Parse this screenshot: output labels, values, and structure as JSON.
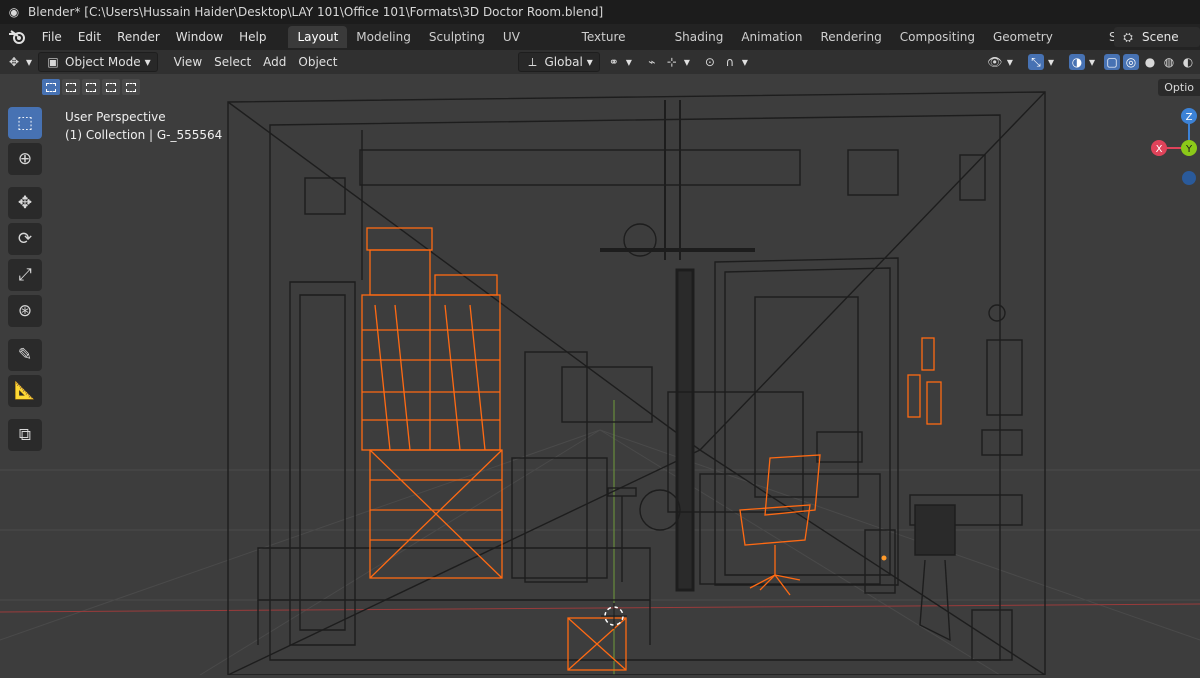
{
  "window": {
    "title": "Blender* [C:\\Users\\Hussain Haider\\Desktop\\LAY 101\\Office 101\\Formats\\3D Doctor Room.blend]"
  },
  "menu": {
    "items": [
      "File",
      "Edit",
      "Render",
      "Window",
      "Help"
    ]
  },
  "workspace_tabs": [
    {
      "label": "Layout",
      "active": true
    },
    {
      "label": "Modeling"
    },
    {
      "label": "Sculpting"
    },
    {
      "label": "UV Editing"
    },
    {
      "label": "Texture Paint"
    },
    {
      "label": "Shading"
    },
    {
      "label": "Animation"
    },
    {
      "label": "Rendering"
    },
    {
      "label": "Compositing"
    },
    {
      "label": "Geometry Nodes"
    },
    {
      "label": "Scripting"
    }
  ],
  "scene": {
    "label": "Scene"
  },
  "header": {
    "mode": "Object Mode",
    "menus": [
      "View",
      "Select",
      "Add",
      "Object"
    ],
    "transform_orientation": "Global"
  },
  "options": {
    "label": "Optio"
  },
  "viewport": {
    "perspective": "User Perspective",
    "collection": "(1) Collection | G-_555564"
  },
  "gizmo": {
    "x_label": "X",
    "y_label": "Y",
    "z_label": "Z"
  },
  "colors": {
    "accent": "#4772b3",
    "selection": "#ff6a13",
    "wire": "#1a1a1a",
    "viewport_bg": "#3d3d3d",
    "axis_x": "#e0435a",
    "axis_y": "#8cc919",
    "axis_z": "#3c82d6"
  },
  "icons": [
    "blender-logo-icon",
    "select-box-icon",
    "cursor-icon",
    "move-icon",
    "rotate-icon",
    "scale-icon",
    "transform-icon",
    "annotate-icon",
    "measure-icon",
    "add-cube-icon"
  ]
}
